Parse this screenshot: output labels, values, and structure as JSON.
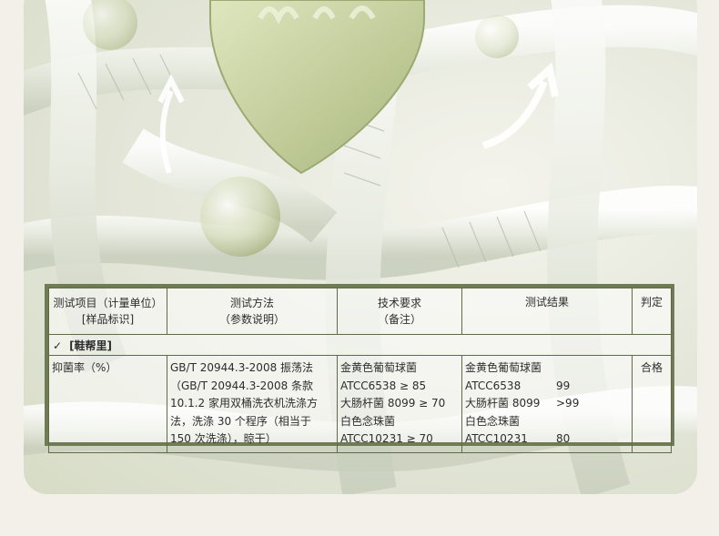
{
  "colors": {
    "frame": "#6f7b55",
    "page_bg": "#f3efe9",
    "tint": "#d7dcc6"
  },
  "table": {
    "headers": [
      {
        "line1": "测试项目（计量单位）",
        "line2": "[样品标识]"
      },
      {
        "line1": "测试方法",
        "line2": "（参数说明）"
      },
      {
        "line1": "技术要求",
        "line2": "（备注）"
      },
      {
        "line1": "测试结果",
        "line2": ""
      },
      {
        "line1": "判定",
        "line2": ""
      }
    ],
    "section": {
      "check": "✓",
      "label": "[鞋帮里]"
    },
    "row": {
      "item": "抑菌率（%）",
      "method": [
        "GB/T 20944.3-2008 振荡法",
        "（GB/T 20944.3-2008 条款",
        "10.1.2 家用双桶洗衣机洗涤方",
        "法，洗涤 30 个程序（相当于",
        "150 次洗涤），晾干）"
      ],
      "requirement": [
        "金黄色葡萄球菌",
        "ATCC6538 ≥ 85",
        "大肠杆菌 8099 ≥ 70",
        "白色念珠菌",
        "ATCC10231 ≥ 70"
      ],
      "results": [
        {
          "label": "金黄色葡萄球菌",
          "value": ""
        },
        {
          "label": "ATCC6538",
          "value": "99"
        },
        {
          "label": "大肠杆菌 8099",
          "value": ">99"
        },
        {
          "label": "白色念珠菌",
          "value": ""
        },
        {
          "label": "ATCC10231",
          "value": "80"
        }
      ],
      "verdict": "合格"
    }
  }
}
